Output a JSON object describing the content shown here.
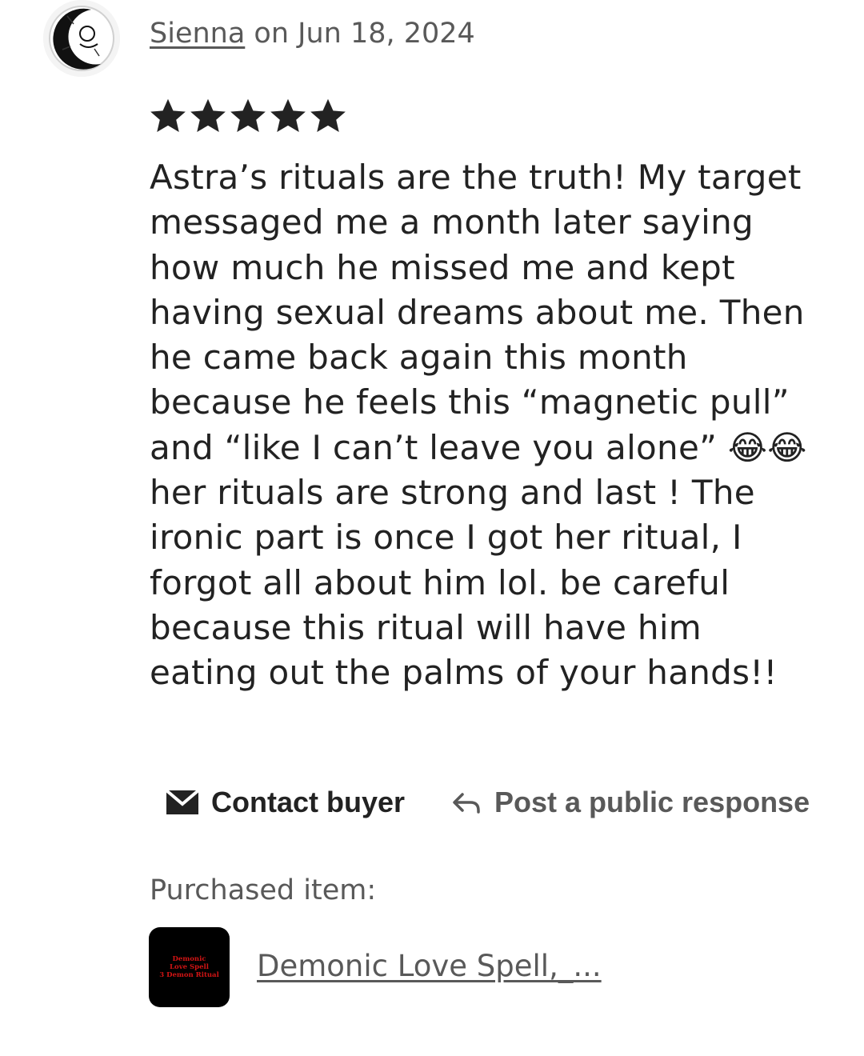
{
  "review": {
    "reviewer_name": "Sienna",
    "date_text": " on Jun 18, 2024",
    "rating": 5,
    "body": "Astra’s rituals are the truth! My target\nmessaged me a month later saying\nhow much he missed me and kept\nhaving sexual dreams about me. Then\nhe came back again this month\nbecause he feels this “magnetic pull”\nand “like I can’t leave you alone” 😂😂\nher rituals are strong and last ! The\nironic part is once I got her ritual, I\nforgot all about him lol. be careful\nbecause this ritual will have him\neating out the palms of your hands!!"
  },
  "actions": {
    "contact_label": "Contact buyer",
    "respond_label": "Post a public response"
  },
  "purchased": {
    "label": "Purchased item:",
    "thumbnail_lines": [
      "Demonic",
      "Love Spell",
      "3 Demon Ritual"
    ],
    "item_title": "Demonic Love Spell,_..."
  },
  "colors": {
    "text_primary": "#222222",
    "text_secondary": "#595959",
    "star": "#222222",
    "thumbnail_bg": "#000000",
    "thumbnail_text": "#d21414"
  }
}
